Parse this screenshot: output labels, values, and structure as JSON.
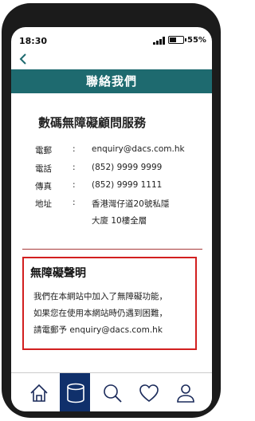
{
  "status_bar": {
    "time": "18:30",
    "battery_percent": "55%",
    "battery_level": 0.55
  },
  "header": {
    "title": "聯絡我們"
  },
  "service": {
    "title": "數碼無障礙顧問服務",
    "contacts": [
      {
        "label": "電郵",
        "colon": ":",
        "value": "enquiry@dacs.com.hk"
      },
      {
        "label": "電話",
        "colon": ":",
        "value": "(852) 9999 9999"
      },
      {
        "label": "傳真",
        "colon": ":",
        "value": "(852) 9999 1111"
      },
      {
        "label": "地址",
        "colon": ":",
        "value": "香港灣仔道20號私隱",
        "value_line2": "大廈 10樓全層"
      }
    ]
  },
  "declaration": {
    "title": "無障礙聲明",
    "lines": [
      "我們在本網站中加入了無障礙功能，",
      "如果您在使用本網站時仍遇到困難，",
      "請電郵予 enquiry@dacs.com.hk"
    ]
  },
  "tabbar": {
    "tabs": [
      {
        "icon": "home-icon"
      },
      {
        "icon": "database-icon",
        "active": true
      },
      {
        "icon": "search-icon"
      },
      {
        "icon": "heart-icon"
      },
      {
        "icon": "user-icon"
      }
    ]
  },
  "colors": {
    "header": "#1e6a6f",
    "active_tab": "#10306b",
    "alert_border": "#d21f1f",
    "back_arrow": "#1e6a6f"
  }
}
